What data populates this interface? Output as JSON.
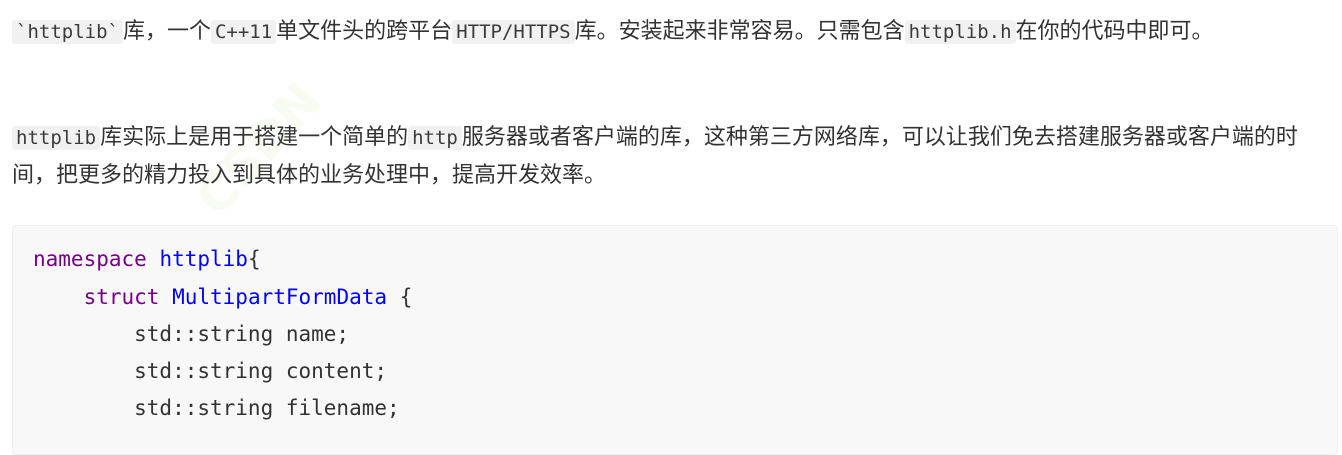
{
  "paragraph1": {
    "code1": "`httplib`",
    "t1": "库，一个",
    "code2": "C++11",
    "t2": "单文件头的跨平台",
    "code3": "HTTP/HTTPS",
    "t3": "库。安装起来非常容易。只需包含",
    "code4": "httplib.h",
    "t4": "在你的代码中即可。"
  },
  "paragraph2": {
    "code1": "httplib",
    "t1": "库实际上是用于搭建一个简单的",
    "code2": "http",
    "t2": "服务器或者客户端的库，这种第三方网络库，可以让我们免去搭建服务器或客户端的时间，把更多的精力投入到具体的业务处理中，提高开发效率。"
  },
  "code": {
    "l1_kw": "namespace",
    "l1_name": "httplib",
    "l1_rest": "{",
    "l2_indent": "    ",
    "l2_kw": "struct",
    "l2_name": "MultipartFormData",
    "l2_rest": "{",
    "l3": "        std::string name;",
    "l4": "        std::string content;",
    "l5": "        std::string filename;"
  },
  "colors": {
    "keyword": "#770088",
    "identifier": "#0000ff",
    "text": "#333333",
    "code_background": "#f8f8f8"
  }
}
